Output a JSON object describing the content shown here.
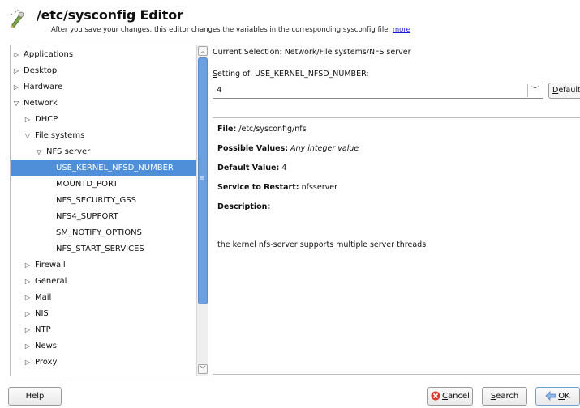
{
  "header": {
    "title": "/etc/sysconfig Editor",
    "subtitle": "After you save your changes, this editor changes the variables in the corresponding sysconfig file.",
    "more_link": "more",
    "icon": "editor-icon"
  },
  "tree": {
    "items": [
      {
        "label": "Applications",
        "arrow": "▷"
      },
      {
        "label": "Desktop",
        "arrow": "▷"
      },
      {
        "label": "Hardware",
        "arrow": "▷"
      },
      {
        "label": "Network",
        "arrow": "▽"
      },
      {
        "label": "DHCP",
        "arrow": "▷"
      },
      {
        "label": "File systems",
        "arrow": "▽"
      },
      {
        "label": "NFS server",
        "arrow": "▽"
      },
      {
        "label": "USE_KERNEL_NFSD_NUMBER",
        "arrow": ""
      },
      {
        "label": "MOUNTD_PORT",
        "arrow": ""
      },
      {
        "label": "NFS_SECURITY_GSS",
        "arrow": ""
      },
      {
        "label": "NFS4_SUPPORT",
        "arrow": ""
      },
      {
        "label": "SM_NOTIFY_OPTIONS",
        "arrow": ""
      },
      {
        "label": "NFS_START_SERVICES",
        "arrow": ""
      },
      {
        "label": "Firewall",
        "arrow": "▷"
      },
      {
        "label": "General",
        "arrow": "▷"
      },
      {
        "label": "Mail",
        "arrow": "▷"
      },
      {
        "label": "NIS",
        "arrow": "▷"
      },
      {
        "label": "NTP",
        "arrow": "▷"
      },
      {
        "label": "News",
        "arrow": "▷"
      },
      {
        "label": "Proxy",
        "arrow": "▷"
      }
    ],
    "selected_label": "USE_KERNEL_NFSD_NUMBER"
  },
  "right": {
    "current_selection": "Current Selection: Network/File systems/NFS server",
    "setting_label_mnemonic": "S",
    "setting_label_rest": "etting of: USE_KERNEL_NFSD_NUMBER:",
    "value": "4",
    "default_button_mnemonic": "D",
    "default_button_rest": "efault"
  },
  "info": {
    "file_label": "File:",
    "file_value": "/etc/sysconfig/nfs",
    "possible_label": "Possible Values:",
    "possible_value": "Any integer value",
    "default_label": "Default Value:",
    "default_value": "4",
    "service_label": "Service to Restart:",
    "service_value": "nfsserver",
    "description_label": "Description:",
    "description_value": "the kernel nfs-server supports multiple server threads"
  },
  "buttons": {
    "help": "Help",
    "cancel_mnemonic": "C",
    "cancel_rest": "ancel",
    "search_mnemonic": "S",
    "search_rest": "earch",
    "ok_mnemonic": "O",
    "ok_rest": "K"
  },
  "colors": {
    "selection": "#4f8ed8",
    "scroll_thumb": "#6ba0e0",
    "link": "#1a1ad6"
  }
}
